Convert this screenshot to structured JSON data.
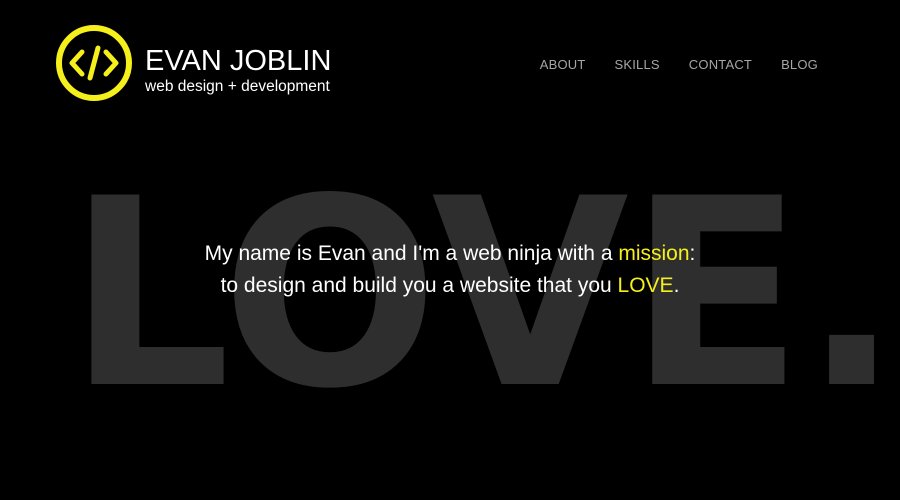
{
  "brand": {
    "name": "EVAN JOBLIN",
    "tagline": "web design + development",
    "accent_color": "#f5ef1b",
    "logo_icon": "code-brackets-icon"
  },
  "nav": {
    "items": [
      {
        "label": "ABOUT"
      },
      {
        "label": "SKILLS"
      },
      {
        "label": "CONTACT"
      },
      {
        "label": "BLOG"
      }
    ]
  },
  "hero": {
    "background_word": "LOVE.",
    "line1_prefix": "My name is Evan and I'm a web ninja with a ",
    "line1_highlight": "mission",
    "line1_suffix": ":",
    "line2_prefix": "to design and build you a website that you ",
    "line2_highlight": "LOVE",
    "line2_suffix": "."
  }
}
